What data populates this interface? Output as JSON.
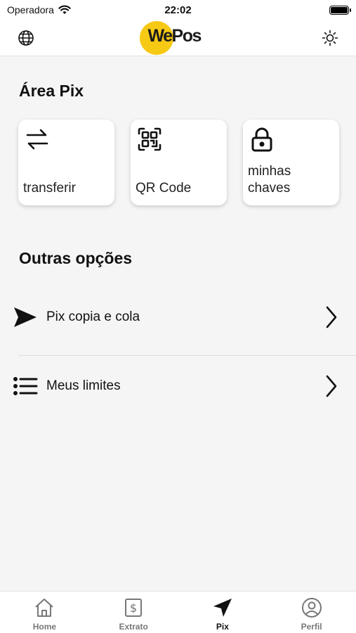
{
  "status_bar": {
    "carrier": "Operadora",
    "time": "22:02"
  },
  "header": {
    "logo_text": "WePos",
    "accent_color": "#f6c915"
  },
  "pix_area": {
    "title": "Área Pix",
    "cards": [
      {
        "label": "transferir",
        "icon": "transfer-arrows-icon"
      },
      {
        "label": "QR Code",
        "icon": "qr-code-icon"
      },
      {
        "label": "minhas chaves",
        "icon": "lock-icon"
      }
    ]
  },
  "other_options": {
    "title": "Outras opções",
    "items": [
      {
        "label": "Pix copia e cola",
        "icon": "send-icon"
      },
      {
        "label": "Meus limites",
        "icon": "list-icon"
      }
    ]
  },
  "tab_bar": {
    "tabs": [
      {
        "label": "Home",
        "icon": "home-icon",
        "active": false
      },
      {
        "label": "Extrato",
        "icon": "dollar-receipt-icon",
        "active": false
      },
      {
        "label": "Pix",
        "icon": "send-icon",
        "active": true
      },
      {
        "label": "Perfil",
        "icon": "user-circle-icon",
        "active": false
      }
    ]
  }
}
